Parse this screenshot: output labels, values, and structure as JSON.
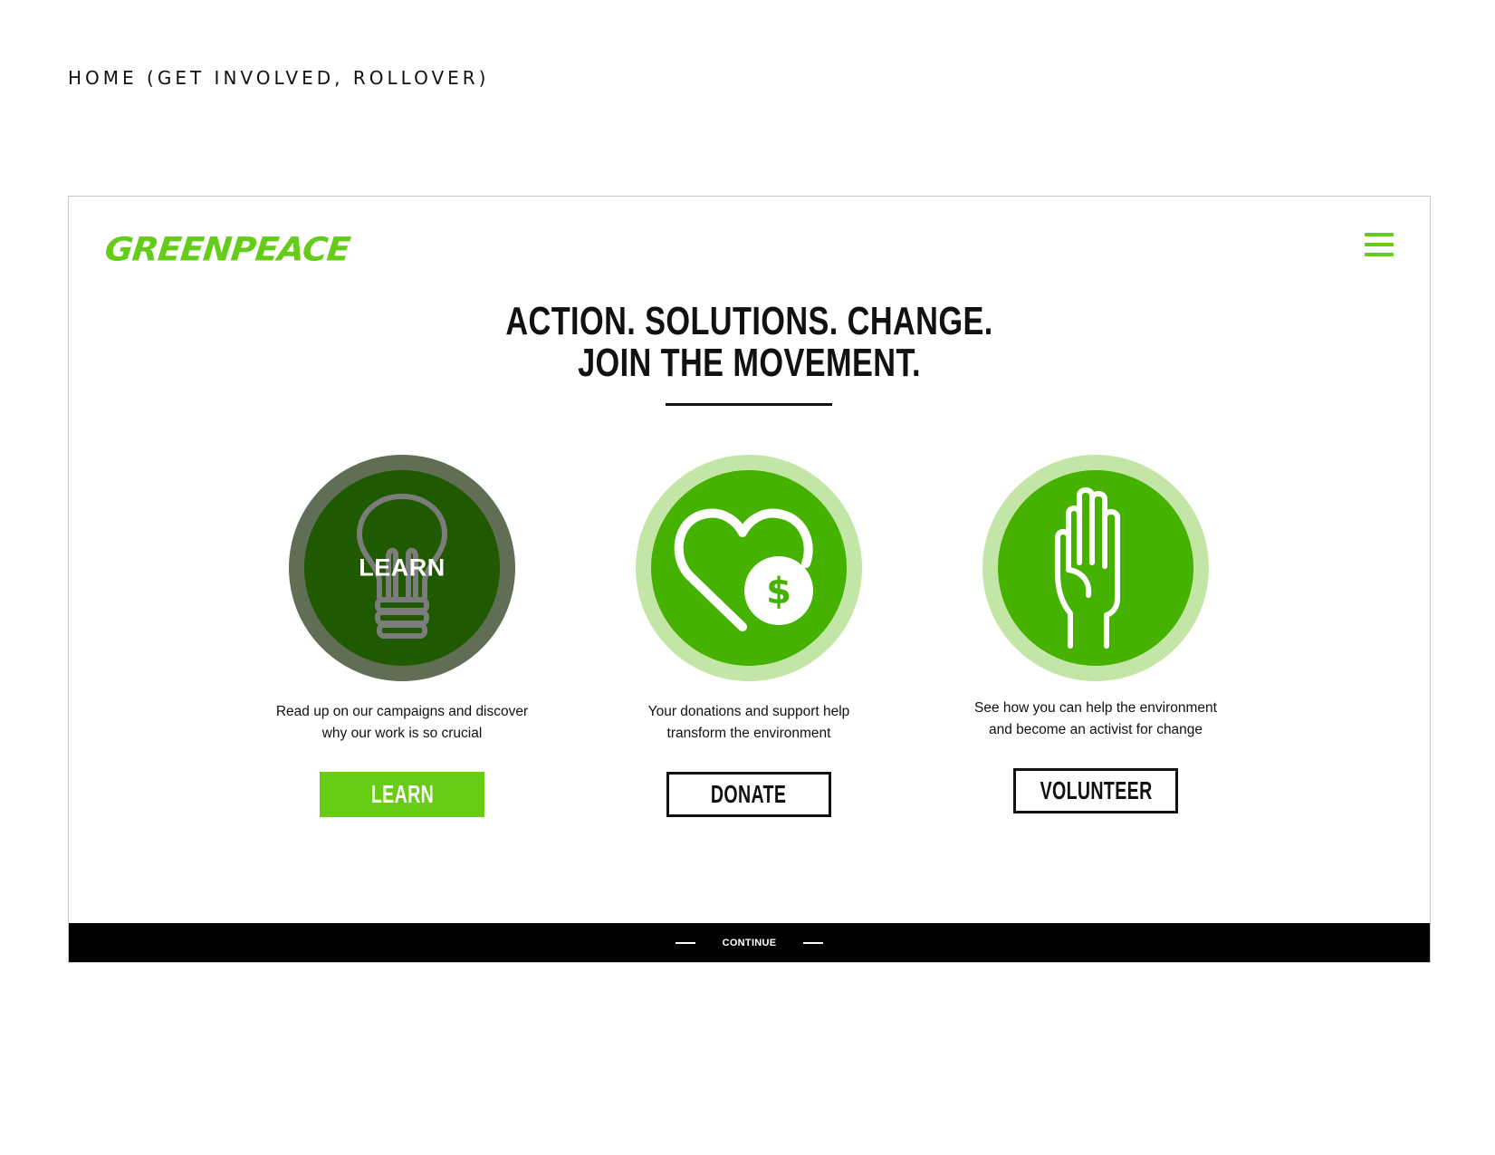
{
  "page_label": "HOME (GET INVOLVED, ROLLOVER)",
  "header": {
    "logo_text": "GREENPEACE",
    "menu_icon": "hamburger-menu-icon"
  },
  "hero": {
    "line1": "ACTION. SOLUTIONS. CHANGE.",
    "line2": "JOIN THE MOVEMENT."
  },
  "cards": {
    "learn": {
      "icon": "lightbulb-icon",
      "rollover_label": "LEARN",
      "desc_line1": "Read up on our campaigns and discover",
      "desc_line2": "why our work is so crucial",
      "button": "LEARN"
    },
    "donate": {
      "icon": "heart-dollar-icon",
      "desc_line1": "Your donations and support help",
      "desc_line2": "transform the environment",
      "button": "DONATE"
    },
    "volunteer": {
      "icon": "raised-hand-icon",
      "desc_line1": "See how you can help the environment",
      "desc_line2": "and become an activist for change",
      "button": "VOLUNTEER"
    }
  },
  "footer": {
    "continue_label": "CONTINUE"
  },
  "colors": {
    "brand_green": "#66cc1a",
    "circle_green": "#46b200",
    "circle_light": "#c3e6a6",
    "rollover_dark": "#1f5a00",
    "rollover_ring": "#5f6e55"
  }
}
